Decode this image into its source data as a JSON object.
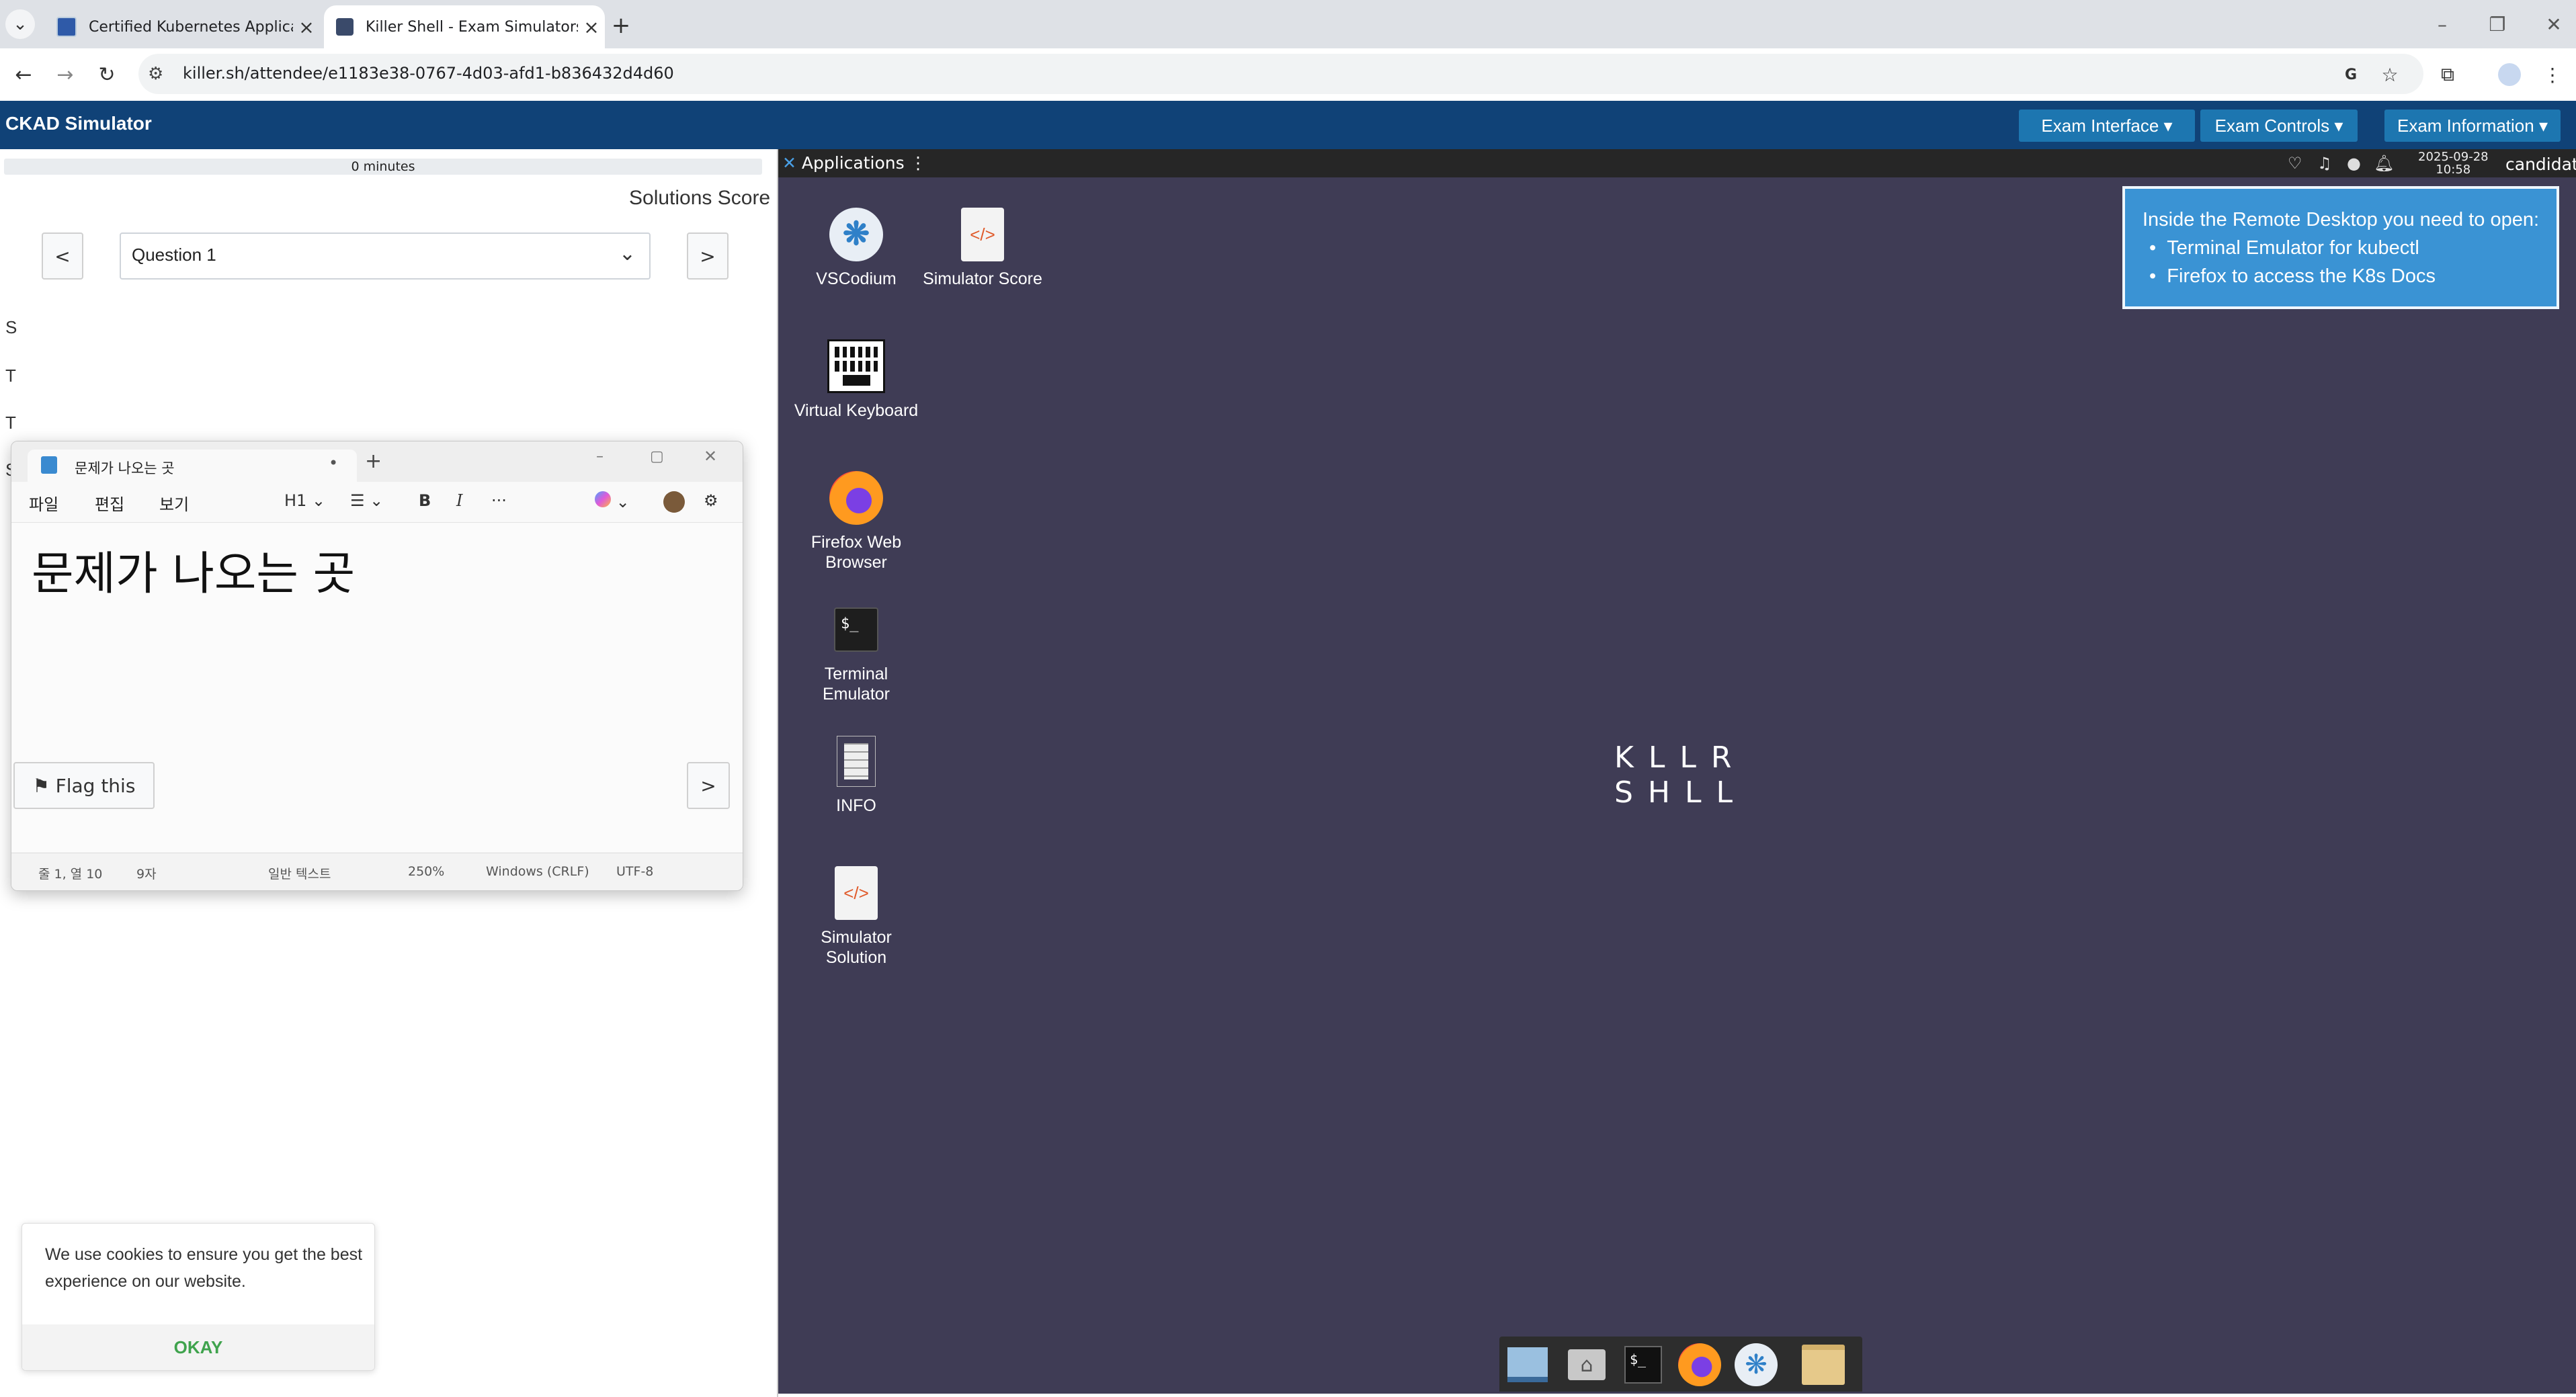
{
  "browser": {
    "tabs": [
      {
        "title": "Certified Kubernetes Applicati",
        "active": false
      },
      {
        "title": "Killer Shell - Exam Simulators",
        "active": true
      }
    ],
    "url": "killer.sh/attendee/e1183e38-0767-4d03-afd1-b836432d4d60"
  },
  "app": {
    "title": "CKAD Simulator",
    "menus": [
      {
        "label": "Exam Interface ▾"
      },
      {
        "label": "Exam Controls ▾"
      },
      {
        "label": "Exam Information ▾"
      }
    ]
  },
  "left": {
    "progress_label": "0 minutes",
    "solutions_score": "Solutions Score",
    "prev": "<",
    "next": ">",
    "question_selected": "Question 1",
    "peek_letters": [
      "S",
      "T",
      "T",
      "S"
    ],
    "flag_label": "⚑ Flag this",
    "flag_next": ">"
  },
  "notepad": {
    "tab_title": "문제가 나오는 곳",
    "menu": [
      "파일",
      "편집",
      "보기"
    ],
    "heading_style": "H1",
    "content": "문제가 나오는 곳",
    "status": {
      "position": "줄 1, 열 10",
      "chars": "9자",
      "format": "일반 텍스트",
      "zoom": "250%",
      "line_ending": "Windows (CRLF)",
      "encoding": "UTF-8"
    }
  },
  "cookie": {
    "text": "We use cookies to ensure you get the best experience on our website.",
    "button": "OKAY"
  },
  "desktop": {
    "applications_label": "Applications ⋮",
    "date": "2025-09-28",
    "time": "10:58",
    "user": "candidate",
    "icons": [
      {
        "name": "vscodium",
        "label": "VSCodium"
      },
      {
        "name": "simulator-score",
        "label": "Simulator Score"
      },
      {
        "name": "virtual-keyboard",
        "label": "Virtual Keyboard"
      },
      {
        "name": "firefox",
        "label": "Firefox Web Browser"
      },
      {
        "name": "terminal",
        "label": "Terminal Emulator"
      },
      {
        "name": "info",
        "label": "INFO"
      },
      {
        "name": "simulator-solution",
        "label": "Simulator Solution"
      }
    ],
    "info_box": {
      "title": "Inside the Remote Desktop you need to open:",
      "items": [
        "Terminal Emulator for kubectl",
        "Firefox to access the K8s Docs"
      ]
    },
    "logo_lines": [
      "KLLR",
      "SHLL"
    ]
  },
  "colors": {
    "app_header": "#104277",
    "exam_button": "#1d76b0",
    "desktop_bg": "#3f3c55",
    "info_box": "#3a93d4",
    "cookie_ok": "#3fa34d"
  }
}
